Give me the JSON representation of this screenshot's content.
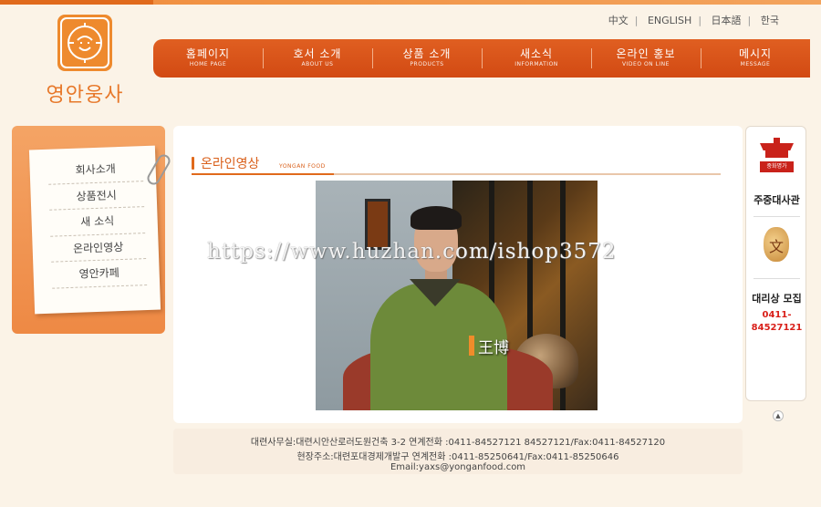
{
  "brand": {
    "name": "영안웅사",
    "logo_icon": "lion-icon",
    "accent": "#e06a1c"
  },
  "languages": [
    "中文",
    "ENGLISH",
    "日本語",
    "한국"
  ],
  "nav": [
    {
      "label": "홈페이지",
      "sub": "HOME PAGE"
    },
    {
      "label": "호서 소개",
      "sub": "ABOUT US"
    },
    {
      "label": "상품 소개",
      "sub": "PRODUCTS"
    },
    {
      "label": "새소식",
      "sub": "INFORMATION"
    },
    {
      "label": "온라인 홍보",
      "sub": "VIDEO ON LINE"
    },
    {
      "label": "메시지",
      "sub": "MESSAGE"
    }
  ],
  "sidebar": {
    "items": [
      "회사소개",
      "상품전시",
      "새 소식",
      "온라인영상",
      "영안카페"
    ]
  },
  "section": {
    "title": "온라인영상",
    "subtitle": "YONGAN FOOD"
  },
  "video": {
    "caption": "王博"
  },
  "watermark": "https://www.huzhan.com/ishop3572",
  "right_panel": {
    "building_label": "중화명가",
    "label1": "주중대사관",
    "label2": "대리상 모집",
    "phone": "0411-84527121",
    "up_icon": "up-arrow-icon"
  },
  "footer": {
    "line1": "대련사무실:대련시안산로러도원건축 3-2   연계전화 :0411-84527121  84527121/Fax:0411-84527120",
    "line2": "현장주소:대련포대경제개발구   연계전화 :0411-85250641/Fax:0411-85250646",
    "line3": "Email:yaxs@yonganfood.com"
  }
}
